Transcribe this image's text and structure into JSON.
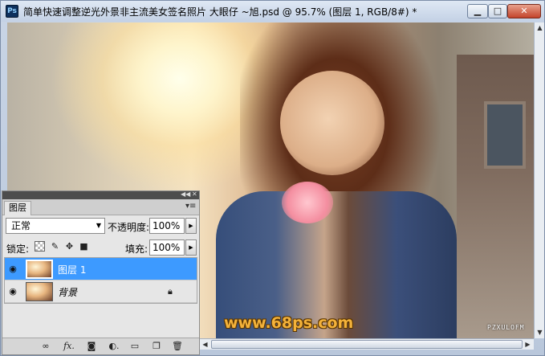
{
  "window": {
    "app_icon": "Ps",
    "title": "简单快速调整逆光外景非主流美女签名照片  大眼仔 ~旭.psd @ 95.7% (图层 1, RGB/8#) *",
    "buttons": {
      "minimize": "minimize-icon",
      "maximize": "maximize-icon",
      "close": "close-icon"
    }
  },
  "canvas": {
    "watermark_site": "www.68ps.com",
    "watermark_corner": "PZXULOFM"
  },
  "layers_panel": {
    "tab_label": "图层",
    "blend_mode": "正常",
    "opacity_label": "不透明度:",
    "opacity_value": "100%",
    "lock_label": "锁定:",
    "fill_label": "填充:",
    "fill_value": "100%",
    "layers": [
      {
        "name": "图层 1",
        "selected": true,
        "visible": true
      },
      {
        "name": "背景",
        "selected": false,
        "visible": true,
        "locked": true
      }
    ],
    "footer_icons": [
      "link-icon",
      "fx-icon",
      "mask-icon",
      "adjustment-icon",
      "group-icon",
      "new-layer-icon",
      "trash-icon"
    ]
  },
  "colors": {
    "selection": "#3d9aff",
    "watermark": "#f3b23a"
  }
}
